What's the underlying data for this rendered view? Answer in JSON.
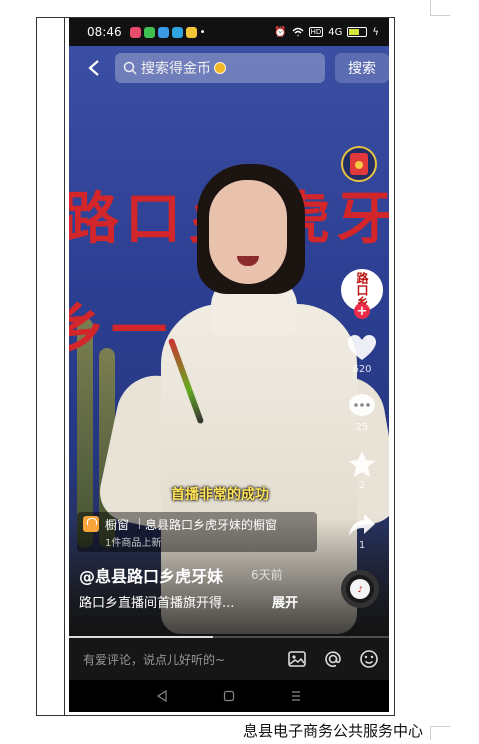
{
  "status_bar": {
    "time": "08:46",
    "signal": "4G",
    "battery": "81"
  },
  "app_icons": [
    {
      "name": "app-icon-red",
      "color": "#e94b6a"
    },
    {
      "name": "app-icon-green",
      "color": "#3fbf52"
    },
    {
      "name": "app-icon-blue",
      "color": "#3a9be8"
    },
    {
      "name": "app-icon-telegram",
      "color": "#2ea4e0"
    },
    {
      "name": "app-icon-yellow",
      "color": "#f4c537"
    }
  ],
  "top": {
    "search_placeholder": "搜索得金币",
    "search_button": "搜索"
  },
  "right_rail": {
    "avatar_text": "路口乡",
    "like_count": "620",
    "comment_count": "25",
    "favorite_count": "2",
    "share_count": "1"
  },
  "video": {
    "banner_line1": "路口乡 虎牙妹",
    "banner_line2": "乡一",
    "subtitle": "首播非常的成功",
    "progress": 0.45
  },
  "shop": {
    "label": "橱窗",
    "name": "息县路口乡虎牙妹的橱窗",
    "sub": "1件商品上新"
  },
  "post": {
    "author": "@息县路口乡虎牙妹",
    "time_ago": "6天前",
    "caption": "路口乡直播间首播旗开得...",
    "expand": "展开"
  },
  "comment_bar": {
    "placeholder": "有爱评论，说点儿好听的~"
  },
  "document": {
    "footer": "息县电子商务公共服务中心"
  }
}
